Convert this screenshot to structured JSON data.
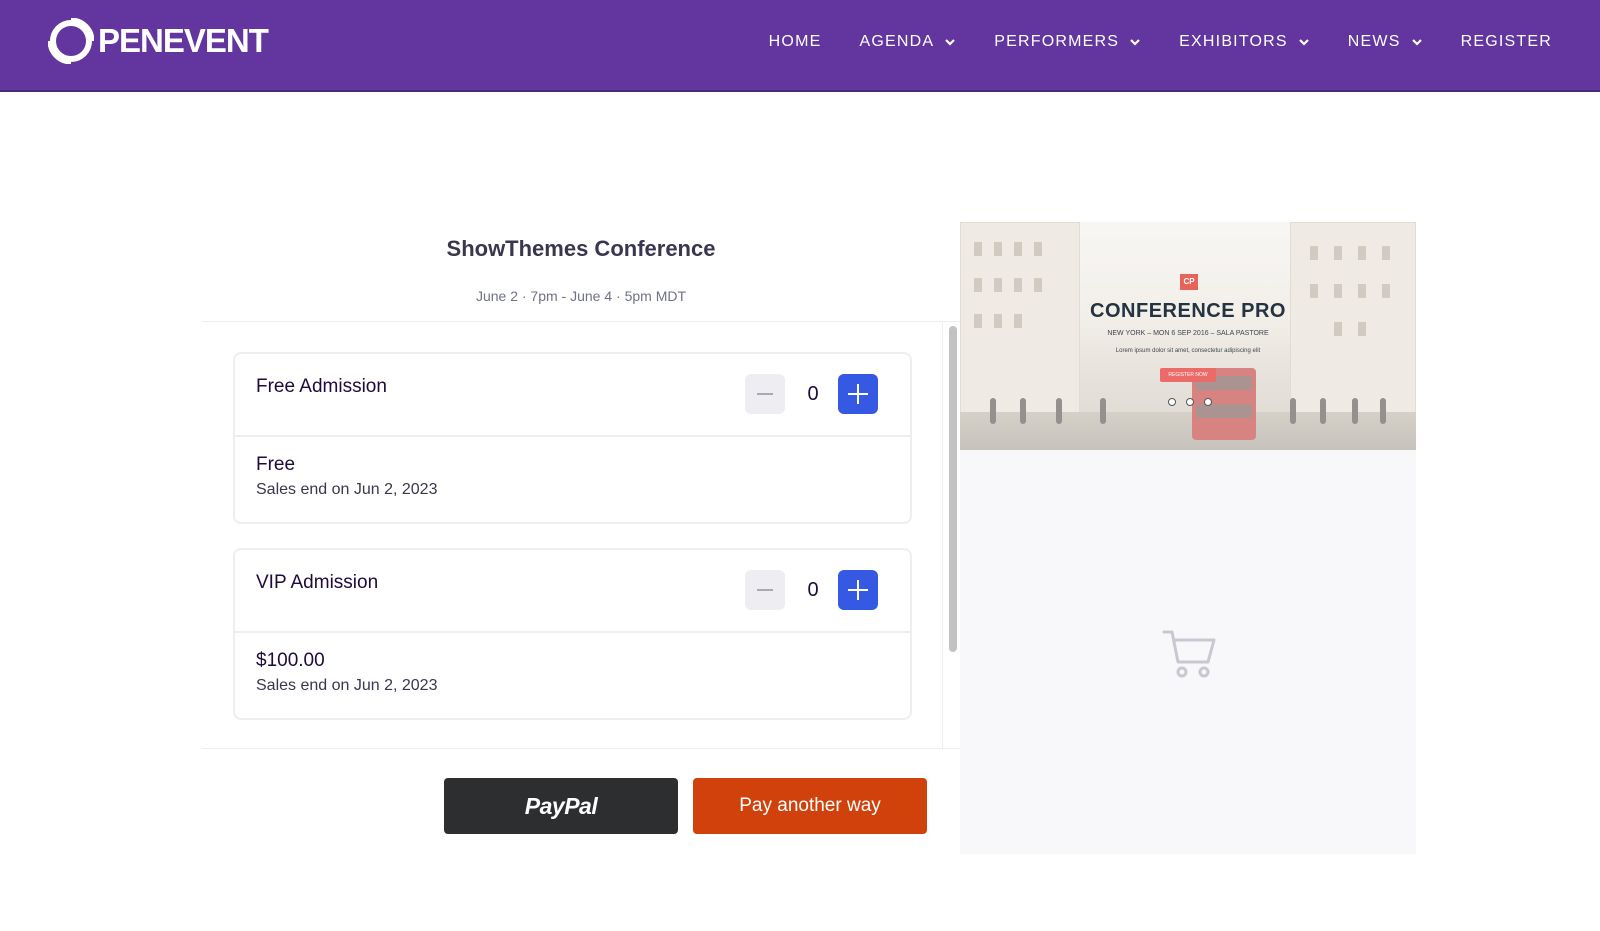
{
  "brand": {
    "name": "OPENEVENT",
    "logo_text": "PENEVENT"
  },
  "nav": {
    "items": [
      {
        "label": "HOME",
        "dropdown": false
      },
      {
        "label": "AGENDA",
        "dropdown": true
      },
      {
        "label": "PERFORMERS",
        "dropdown": true
      },
      {
        "label": "EXHIBITORS",
        "dropdown": true
      },
      {
        "label": "NEWS",
        "dropdown": true
      },
      {
        "label": "REGISTER",
        "dropdown": false
      }
    ]
  },
  "event": {
    "title": "ShowThemes Conference",
    "date": "June 2 · 7pm - June 4 · 5pm MDT"
  },
  "tickets": [
    {
      "name": "Free Admission",
      "price": "Free",
      "sales_end": "Sales end on Jun 2, 2023",
      "quantity": "0"
    },
    {
      "name": "VIP Admission",
      "price": "$100.00",
      "sales_end": "Sales end on Jun 2, 2023",
      "quantity": "0"
    }
  ],
  "actions": {
    "paypal_label": "PayPal",
    "other_label": "Pay another way"
  },
  "banner": {
    "badge": "CP",
    "title": "CONFERENCE PRO",
    "subtitle": "NEW YORK – MON 6 SEP 2016 – SALA PASTORE",
    "lorem": "Lorem ipsum dolor sit amet, consectetur adipiscing elit",
    "button": "REGISTER NOW"
  },
  "colors": {
    "nav_bg": "#63369f",
    "plus_button": "#3659e3",
    "pay_other": "#d1410c",
    "paypal": "#2c2e2f"
  },
  "icons": {
    "chevron": "chevron-down-icon",
    "minus": "minus-icon",
    "plus": "plus-icon",
    "cart": "cart-icon"
  }
}
